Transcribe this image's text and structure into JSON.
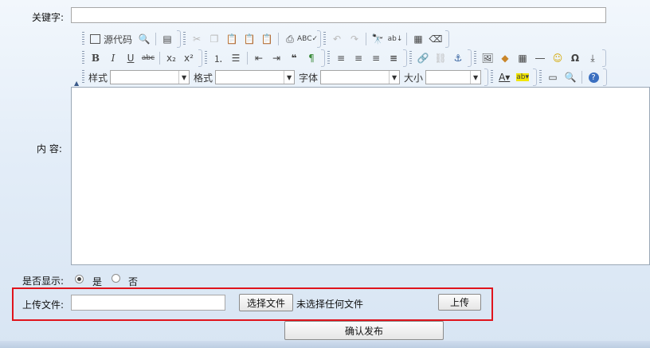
{
  "form": {
    "keyword_label": "关键字:",
    "keyword_value": "",
    "content_label": "内 容:",
    "display_label": "是否显示:",
    "display_yes": "是",
    "display_no": "否",
    "display_selected": "是",
    "upload_label": "上传文件:",
    "choose_file_label": "选择文件",
    "no_file_text": "未选择任何文件",
    "upload_button": "上传",
    "submit_button": "确认发布"
  },
  "toolbar": {
    "source_label": "源代码",
    "style_label": "样式",
    "format_label": "格式",
    "font_label": "字体",
    "size_label": "大小",
    "style_value": "",
    "format_value": "",
    "font_value": "",
    "size_value": ""
  },
  "colors": {
    "highlight_border": "#e0141c",
    "page_background": "#e3edf8"
  }
}
